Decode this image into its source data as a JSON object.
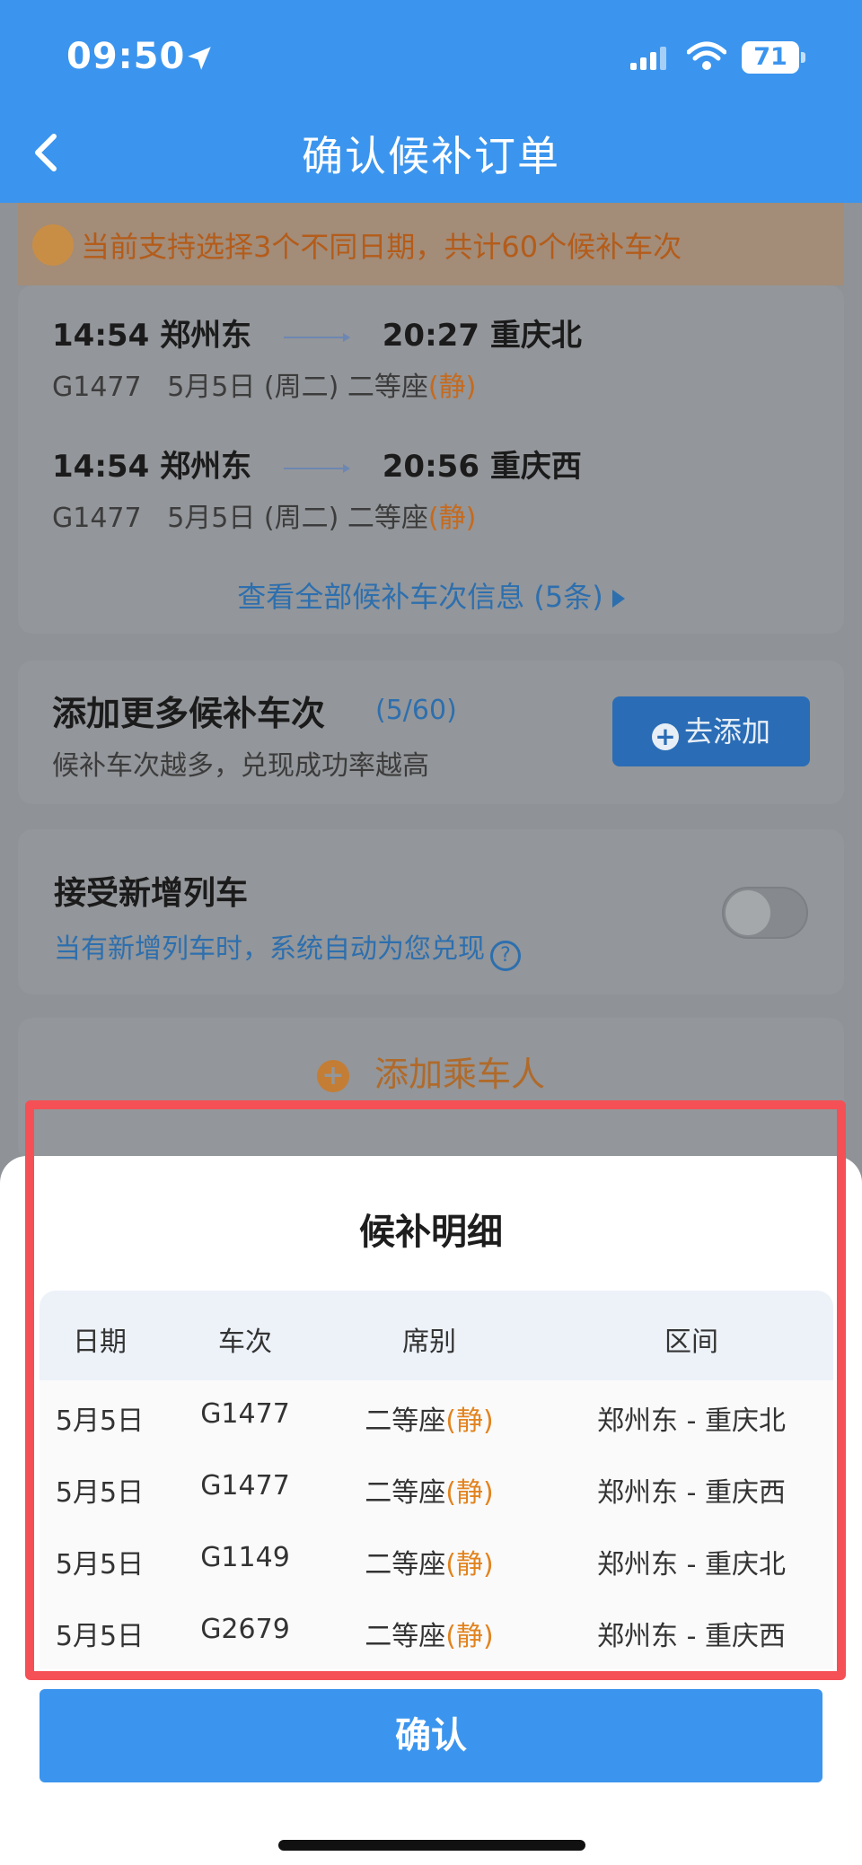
{
  "status_bar": {
    "time": "09:50",
    "battery": "71"
  },
  "header": {
    "title": "确认候补订单"
  },
  "notice": {
    "text": "当前支持选择3个不同日期，共计60个候补车次"
  },
  "trips": [
    {
      "dep_time": "14:54",
      "dep_station": "郑州东",
      "arr_time": "20:27",
      "arr_station": "重庆北",
      "train": "G1477",
      "date": "5月5日 (周二)",
      "seat": "二等座",
      "tag": "(静)"
    },
    {
      "dep_time": "14:54",
      "dep_station": "郑州东",
      "arr_time": "20:56",
      "arr_station": "重庆西",
      "train": "G1477",
      "date": "5月5日 (周二)",
      "seat": "二等座",
      "tag": "(静)"
    }
  ],
  "view_all": "查看全部候补车次信息 (5条)",
  "add_more": {
    "title": "添加更多候补车次",
    "count": "(5/60)",
    "subtitle": "候补车次越多，兑现成功率越高",
    "button": "去添加"
  },
  "accept_new": {
    "title": "接受新增列车",
    "subtitle": "当有新增列车时，系统自动为您兑现"
  },
  "add_passenger": "添加乘车人",
  "sheet": {
    "title": "候补明细",
    "headers": [
      "日期",
      "车次",
      "席别",
      "区间"
    ],
    "rows": [
      {
        "date": "5月5日",
        "train": "G1477",
        "seat": "二等座",
        "tag": "(静)",
        "route": "郑州东 - 重庆北"
      },
      {
        "date": "5月5日",
        "train": "G1477",
        "seat": "二等座",
        "tag": "(静)",
        "route": "郑州东 - 重庆西"
      },
      {
        "date": "5月5日",
        "train": "G1149",
        "seat": "二等座",
        "tag": "(静)",
        "route": "郑州东 - 重庆北"
      },
      {
        "date": "5月5日",
        "train": "G2679",
        "seat": "二等座",
        "tag": "(静)",
        "route": "郑州东 - 重庆西"
      }
    ],
    "confirm": "确认"
  },
  "colors": {
    "primary": "#3b95ee",
    "accent_orange": "#e2831e",
    "highlight_border": "#f45055"
  }
}
